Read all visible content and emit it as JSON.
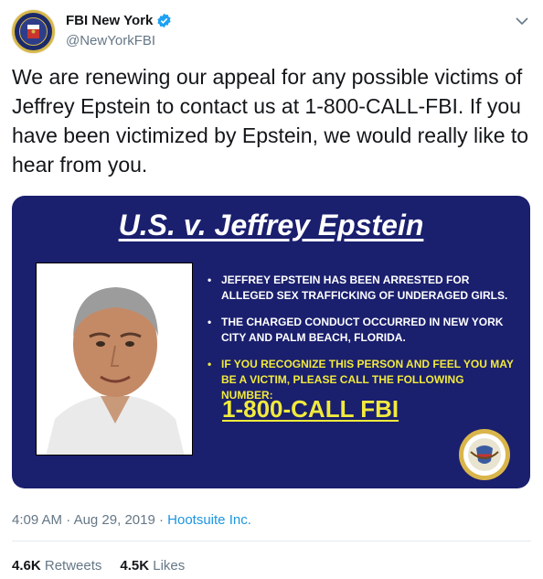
{
  "account": {
    "display_name": "FBI New York",
    "handle": "@NewYorkFBI"
  },
  "tweet": {
    "text": "We are renewing our appeal for any possible victims of Jeffrey Epstein to contact us at 1-800-CALL-FBI.  If you have been victimized by Epstein, we would really like to hear from you."
  },
  "media": {
    "title": "U.S. v. Jeffrey Epstein",
    "bullets": [
      "JEFFREY EPSTEIN HAS BEEN ARRESTED FOR ALLEGED SEX TRAFFICKING OF UNDERAGED GIRLS.",
      "THE CHARGED CONDUCT OCCURRED IN NEW YORK CITY AND PALM BEACH, FLORIDA.",
      "IF YOU RECOGNIZE THIS PERSON AND FEEL YOU MAY BE A VICTIM, PLEASE CALL THE FOLLOWING NUMBER:"
    ],
    "phone": "1-800-CALL FBI",
    "bg_color": "#1a1f6e",
    "highlight_color": "#f1ea3c"
  },
  "meta": {
    "time": "4:09 AM",
    "separator": "·",
    "date": "Aug 29, 2019",
    "source": "Hootsuite Inc."
  },
  "stats": {
    "retweets_count": "4.6K",
    "retweets_label": "Retweets",
    "likes_count": "4.5K",
    "likes_label": "Likes"
  },
  "icons": [
    "fbi-seal-icon",
    "verified-badge-icon",
    "chevron-down-icon",
    "doj-seal-icon"
  ]
}
